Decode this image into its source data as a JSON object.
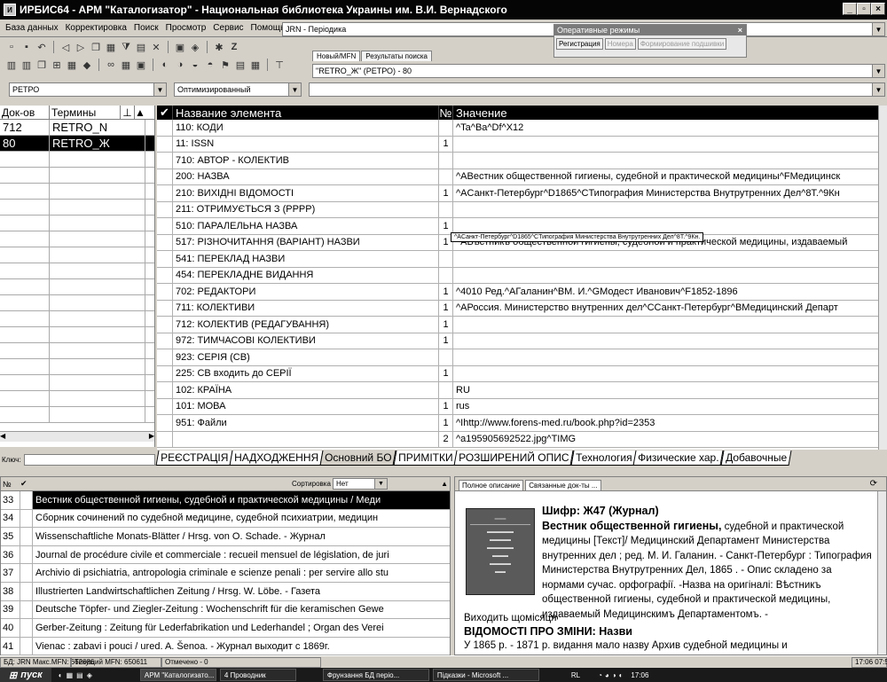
{
  "window": {
    "title": "ИРБИС64 - АРМ \"Каталогизатор\" - Национальная библиотека Украины им. В.И. Вернадского",
    "min": "_",
    "max": "▫",
    "close": "×"
  },
  "menu": [
    "База данных",
    "Корректировка",
    "Поиск",
    "Просмотр",
    "Сервис",
    "Помощь"
  ],
  "db_combo": "JRN - Періодика",
  "opmodes": {
    "title": "Оперативные режимы",
    "buttons": [
      "Регистрация",
      "Номера",
      "Формирование подшивки"
    ]
  },
  "subtabs": [
    "Новый/MFN",
    "Результаты поиска"
  ],
  "search_combo": "\"RETRO_Ж\" (РЕТРО) - 80",
  "dict_combo": "РЕТРО",
  "mode_combo": "Оптимизированный",
  "left_list": {
    "headers": [
      "Док-ов",
      "Термины"
    ],
    "rows": [
      {
        "count": "712",
        "term": "RETRO_N"
      },
      {
        "count": "80",
        "term": "RETRO_Ж"
      }
    ]
  },
  "key_label": "Ключ:",
  "grid": {
    "headers": [
      "Название элемента",
      "№",
      "Значение"
    ],
    "rows": [
      {
        "name": "110: КОДИ",
        "num": "",
        "value": "^Ta^Ba^Df^X12"
      },
      {
        "name": "11: ISSN",
        "num": "1",
        "value": ""
      },
      {
        "name": "710: АВТОР - КОЛЕКТИВ",
        "num": "",
        "value": ""
      },
      {
        "name": "200: НАЗВА",
        "num": "",
        "value": "^AВестник общественной гигиены, судебной и практической медицины^FМедицинск"
      },
      {
        "name": "210: ВИХІДНІ ВІДОМОСТІ",
        "num": "1",
        "value": "^AСанкт-Петербург^D1865^CТипография Министерства Внутрутренних Дел^8Т.^9Кн"
      },
      {
        "name": "211: ОТРИМУЄТЬСЯ З (РРРР)",
        "num": "",
        "value": ""
      },
      {
        "name": "510: ПАРАЛЕЛЬНА НАЗВА",
        "num": "1",
        "value": ""
      },
      {
        "name": "517: РІЗНОЧИТАННЯ (ВАРІАНТ) НАЗВИ",
        "num": "1",
        "value": "^AВѣстникъ общественной гигиены, судебной и практической медицины, издаваемый"
      },
      {
        "name": "541: ПЕРЕКЛАД НАЗВИ",
        "num": "",
        "value": ""
      },
      {
        "name": "454: ПЕРЕКЛАДНЕ ВИДАННЯ",
        "num": "",
        "value": ""
      },
      {
        "name": "702:  РЕДАКТОРИ",
        "num": "1",
        "value": "^4010 Ред.^AГаланин^BМ. И.^GМодест Иванович^F1852-1896"
      },
      {
        "name": "711: КОЛЕКТИВИ",
        "num": "1",
        "value": "^AРоссия. Министерство внутренних дел^CСанкт-Петербург^BМедицинский Департ"
      },
      {
        "name": "712: КОЛЕКТИВ (РЕДАГУВАННЯ)",
        "num": "1",
        "value": ""
      },
      {
        "name": "972: ТИМЧАСОВІ КОЛЕКТИВИ",
        "num": "1",
        "value": ""
      },
      {
        "name": "923: СЕРІЯ (СВ)",
        "num": "",
        "value": ""
      },
      {
        "name": "225: СВ входить до СЕРІЇ",
        "num": "1",
        "value": ""
      },
      {
        "name": "102: КРАЇНА",
        "num": "",
        "value": "RU"
      },
      {
        "name": "101: МОВА",
        "num": "1",
        "value": "rus"
      },
      {
        "name": "951: Файли",
        "num": "1",
        "value": "^Ihttp://www.forens-med.ru/book.php?id=2353"
      },
      {
        "name": "",
        "num": "2",
        "value": "^a195905692522.jpg^TIMG"
      }
    ],
    "tooltip": "^AСанкт-Петербург^D1865^CТипография Министерства Внутрутренних Дел^8Т.^9Кн."
  },
  "bottom_tabs": [
    "РЕЄСТРАЦІЯ",
    "НАДХОДЖЕННЯ",
    "Основний БО",
    "ПРИМІТКИ",
    "РОЗШИРЕНИЙ ОПИС",
    "Технология",
    "Физические хар.",
    "Добавочные"
  ],
  "records": {
    "header_num": "№",
    "sort_label": "Сортировка",
    "sort_value": "Нет",
    "rows": [
      {
        "n": "33",
        "t": "Вестник общественной гигиены, судебной и практической медицины / Меди"
      },
      {
        "n": "34",
        "t": "Сборник сочинений по судебной медицине, судебной психиатрии, медицин"
      },
      {
        "n": "35",
        "t": "Wissenschaftliche Monats-Blätter / Hrsg. von O. Schade. - Журнал"
      },
      {
        "n": "36",
        "t": "Journal de procédure civile et commerciale : recueil mensuel de législation, de juri"
      },
      {
        "n": "37",
        "t": "Archivio di psichiatria, antropologia criminale e scienze penali : per servire allo stu"
      },
      {
        "n": "38",
        "t": "Illustrierten Landwirtschaftlichen Zeitung / Hrsg. W. Löbe. - Газета"
      },
      {
        "n": "39",
        "t": "Deutsche Töpfer- und Ziegler-Zeitung : Wochenschrift für die keramischen Gewe"
      },
      {
        "n": "40",
        "t": "Gerber-Zeitung : Zeitung für Lederfabrikation und Lederhandel ; Organ des Verei"
      },
      {
        "n": "41",
        "t": "Vienac : zabavi i pouci / ured. A. Šenoa. - Журнал выходит с 1869г."
      }
    ]
  },
  "desc": {
    "tabs": [
      "Полное описание",
      "Связанные док-ты ..."
    ],
    "cipher": "Шифр: Ж47 (Журнал)",
    "title_bold": "Вестник общественной гигиены,",
    "body": "судебной и практической медицины [Текст]/ Медицинский Департамент Министерства внутренних дел ; ред. М. И. Галанин. - Санкт-Петербург : Типография Министерства Внутрутренних Дел, 1865 . - Опис складено за нормами сучас. орфографії. -Назва на оригіналі: Вѣстникъ общественной гигиены, судебной и практической медицины, издаваемый Медицинскимъ Департаментомъ. -",
    "line1": "Виходить щомісяця",
    "heading": "ВІДОМОСТІ ПРО ЗМІНИ: Назви",
    "line2": "У 1865 р. - 1871 р. видання мало назву Архив судебной медицины и"
  },
  "status": [
    "БД: JRN Макс.MFN: 662686",
    "Текущий MFN: 650611",
    "Отмечено - 0",
    "17:06 07:5"
  ],
  "taskbar": {
    "start": "пуск",
    "tasks": [
      "АРМ \"Каталогизато...",
      "4 Проводник",
      "Фрунзання БД періо...",
      "Підказки - Microsoft ..."
    ],
    "lang": "RL",
    "clock": "17:06"
  }
}
